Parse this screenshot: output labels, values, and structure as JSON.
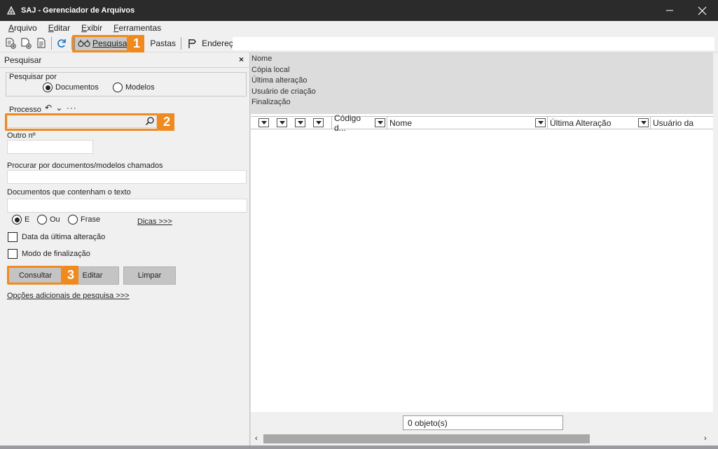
{
  "window": {
    "title": "SAJ - Gerenciador de Arquivos"
  },
  "menu": [
    "Arquivo",
    "Editar",
    "Exibir",
    "Ferramentas"
  ],
  "toolbar": {
    "search_label": "Pesquisar",
    "folders_label": "Pastas",
    "address_label": "Endereço",
    "address_value": ""
  },
  "callouts": [
    "1",
    "2",
    "3"
  ],
  "left_panel": {
    "title": "Pesquisar",
    "close_glyph": "×",
    "search_by_label": "Pesquisar por",
    "radio_documents": "Documentos",
    "radio_models": "Modelos",
    "selected_type": "Documentos",
    "process_label": "Processo",
    "process_history_glyphs": "↶ ⌄ ···",
    "other_number_label": "Outro nº",
    "find_named_label": "Procurar por documentos/modelos chamados",
    "contains_text_label": "Documentos que contenham o texto",
    "mode_and": "E",
    "mode_or": "Ou",
    "mode_phrase": "Frase",
    "selected_mode": "E",
    "tips_link": "Dicas >>>",
    "last_change_date_label": "Data da última alteração",
    "finalization_mode_label": "Modo de finalização",
    "consult_button": "Consultar",
    "edit_button": "Editar",
    "clear_button": "Limpar",
    "more_options_link": "Opções adicionais de pesquisa >>>"
  },
  "right_panel": {
    "properties": [
      "Nome",
      "Cópia local",
      "Última alteração",
      "Usuário de criação",
      "Finalização"
    ],
    "columns": [
      "Código d...",
      "Nome",
      "Última Alteração",
      "Usuário da"
    ],
    "status": "0 objeto(s)"
  }
}
